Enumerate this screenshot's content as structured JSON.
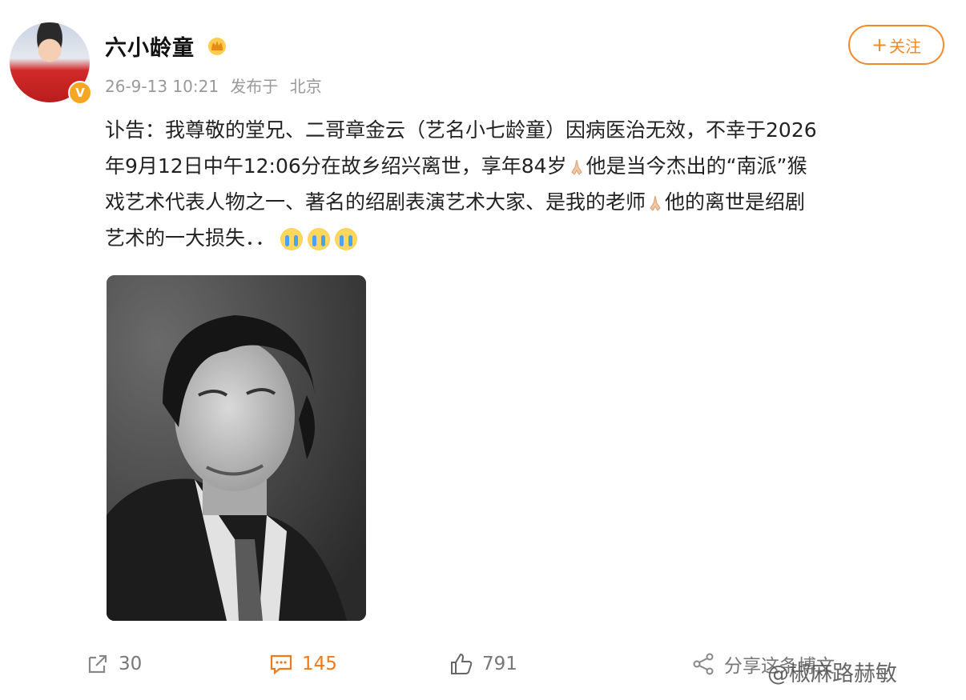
{
  "user": {
    "name": "六小龄童",
    "verified_mark": "V",
    "timestamp": "26-9-13 10:21",
    "posted_from_label": "发布于",
    "location": "北京"
  },
  "follow_button": {
    "plus": "+",
    "label": "关注"
  },
  "post": {
    "line1": "讣告：我尊敬的堂兄、二哥章金云（艺名小七龄童）因病医治无效，不幸于2026",
    "line2a": "年9月12日中午12:06分在故乡绍兴离世，享年84岁",
    "line2b": "他是当今杰出的“南派”猴",
    "line3a": "戏艺术代表人物之一、著名的绍剧表演艺术大家、是我的老师",
    "line3b": "他的离世是绍剧",
    "line4": "艺术的一大损失．．"
  },
  "actions": {
    "repost_count": "30",
    "comment_count": "145",
    "like_count": "791",
    "share_label": "分享这条博文"
  },
  "watermark": "@椒麻路赫敏",
  "colors": {
    "accent": "#f08a2a",
    "comment": "#f07a1a",
    "muted": "#999999"
  },
  "icons": [
    "share-icon",
    "comment-icon",
    "like-icon",
    "share-network-icon",
    "crown-badge-icon",
    "praying-hands-icon",
    "crying-face-icon"
  ]
}
